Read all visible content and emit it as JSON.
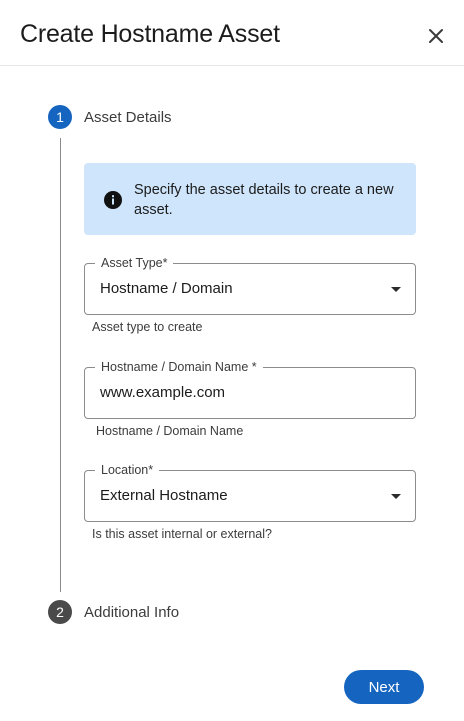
{
  "dialog": {
    "title": "Create Hostname Asset",
    "close_icon": "close-icon"
  },
  "stepper": {
    "steps": [
      {
        "number": "1",
        "label": "Asset Details",
        "state": "active",
        "color": "#1565c0"
      },
      {
        "number": "2",
        "label": "Additional Info",
        "state": "inactive",
        "color": "#4a4a4a"
      }
    ]
  },
  "info_banner": {
    "icon": "info-icon",
    "text": "Specify the asset details to create a new asset.",
    "background": "#cfe5fb"
  },
  "form": {
    "asset_type": {
      "label": "Asset Type*",
      "value": "Hostname / Domain",
      "helper": "Asset type to create",
      "control": "select"
    },
    "hostname": {
      "label": "Hostname / Domain Name *",
      "value": "www.example.com",
      "helper": "Hostname / Domain Name",
      "control": "text"
    },
    "location": {
      "label": "Location*",
      "value": "External Hostname",
      "helper": "Is this asset internal or external?",
      "control": "select"
    }
  },
  "actions": {
    "next_label": "Next",
    "accent": "#1565c0"
  }
}
